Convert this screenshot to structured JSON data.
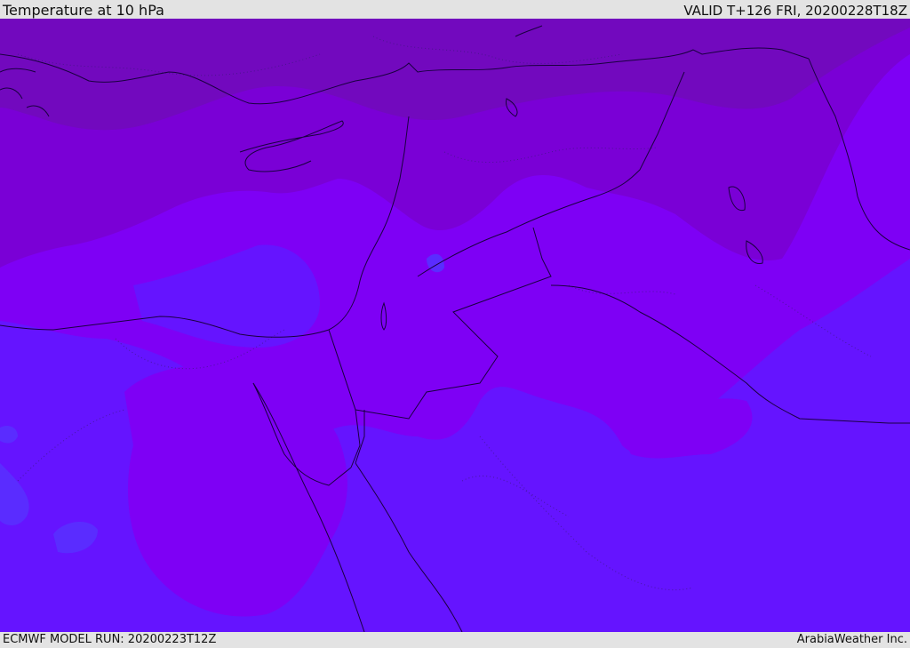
{
  "header": {
    "title": "Temperature at 10 hPa",
    "valid": "VALID T+126 FRI, 20200228T18Z"
  },
  "footer": {
    "model_run": "ECMWF MODEL RUN: 20200223T12Z",
    "credit": "ArabiaWeather Inc."
  },
  "colors": {
    "darkest_purple": "#7209be",
    "dark_purple": "#7a00d6",
    "purple": "#7e00f5",
    "violet_blue": "#6514ff",
    "blue": "#5a2cff",
    "coastline": "#1a0040"
  }
}
